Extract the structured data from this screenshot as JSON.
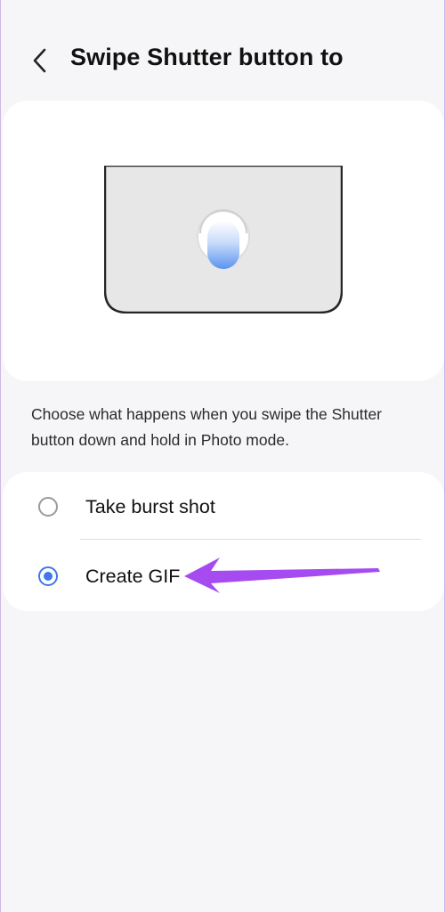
{
  "header": {
    "title": "Swipe Shutter button to",
    "back_icon": "chevron-left-icon"
  },
  "illustration": {
    "icon": "phone-swipe-shutter-illustration",
    "accent_color": "#5b93f0"
  },
  "description": "Choose what happens when you swipe the Shutter button down and hold in Photo mode.",
  "options": [
    {
      "label": "Take burst shot",
      "selected": false
    },
    {
      "label": "Create GIF",
      "selected": true
    }
  ],
  "annotation": {
    "icon": "purple-arrow-icon",
    "color": "#a64bf0"
  },
  "colors": {
    "background": "#f6f6f8",
    "card": "#ffffff",
    "radio_selected": "#3e79e6"
  }
}
